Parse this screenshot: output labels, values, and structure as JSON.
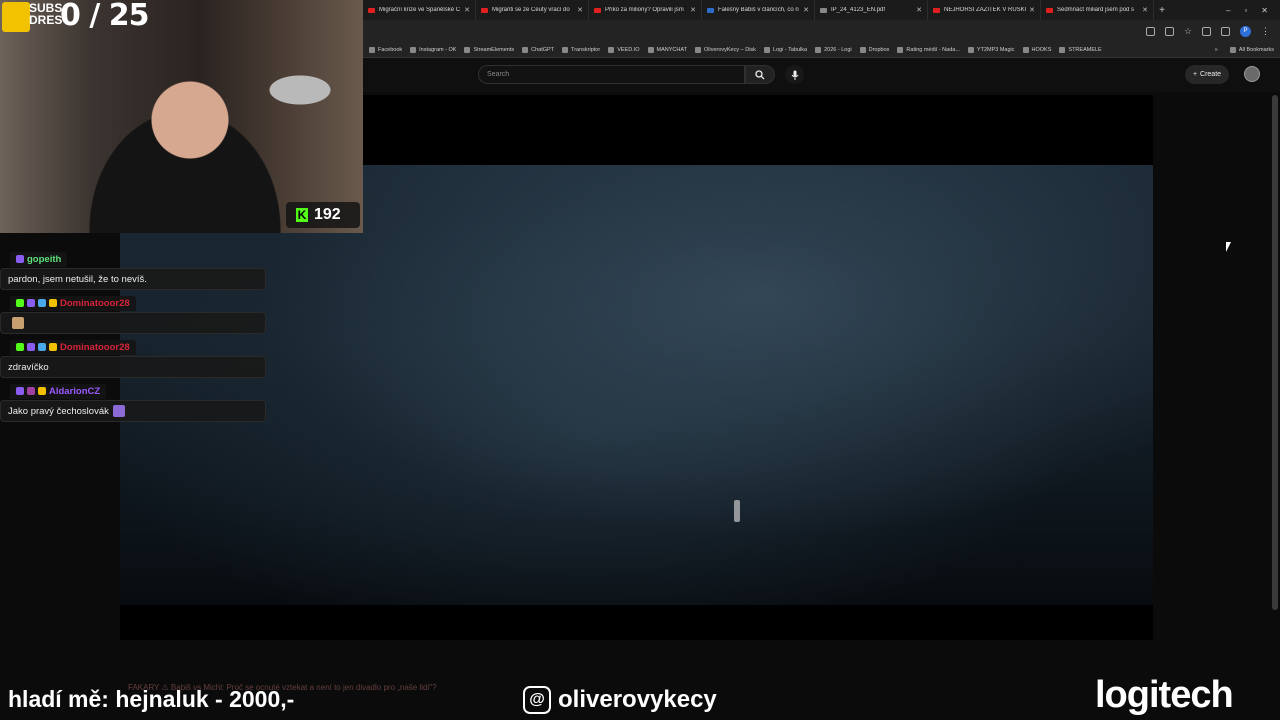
{
  "browser": {
    "tabs": [
      {
        "title": "Migrační krize ve Španělské C",
        "icon": "youtube-icon"
      },
      {
        "title": "Migranti se ze Ceuty vrací do",
        "icon": "youtube-icon"
      },
      {
        "title": "Příko za miliony? Opravili jsm",
        "icon": "youtube-icon"
      },
      {
        "title": "Falešný Babiš v článcích, co n",
        "icon": "szz-icon"
      },
      {
        "title": "IP_24_4123_EN.pdf",
        "icon": "pdf-icon"
      },
      {
        "title": "NEJHORŠÍ ZÁŽITEK V RUSKU!",
        "icon": "youtube-icon"
      },
      {
        "title": "Sedmnáct miliard jsem pod s",
        "icon": "youtube-icon"
      }
    ],
    "new_tab": "+",
    "window_controls": [
      "–",
      "▫",
      "✕"
    ],
    "profile_initial": "P",
    "bookmarks": [
      "Facebook",
      "Instagram - OK",
      "StreamElements",
      "ChatGPT",
      "Transkriptor",
      "VEED.IO",
      "MANYCHAT",
      "OliverovyKecy – Disk",
      "Logi - Tabulka",
      "2026 - Logi",
      "Dropbox",
      "Rating médií - Nada...",
      "YT2MP3 Magic",
      "HOOKS",
      "STREAMELE"
    ],
    "bookmarks_more": "»",
    "all_bookmarks": "All Bookmarks"
  },
  "youtube": {
    "search_placeholder": "Search",
    "create_label": "Create"
  },
  "overlay": {
    "subs_logo": "SUBS DRES",
    "subs_count": "0 / 25",
    "kick_count": "192",
    "ticker": "FAKARY ⚠ Babiš vs Michl: Proč se ocnuté vztekat a není to jen divadlo pro „naše lidi\"?",
    "bottom_left": "hladí mě: hejnaluk - 2000,-",
    "threads_handle": "oliverovykecy",
    "sponsor": "logitech"
  },
  "chat": [
    {
      "user": "gopeith",
      "color": "#5ee07a",
      "badges": [
        "#8a5cf0"
      ],
      "text": "pardon, jsem netušil, že to nevíš.",
      "emote": false
    },
    {
      "user": "Dominatooor28",
      "color": "#d6243a",
      "badges": [
        "#53fc18",
        "#8a5cf0",
        "#4aa8e8",
        "#f2c200"
      ],
      "text": "",
      "emote": true
    },
    {
      "user": "Dominatooor28",
      "color": "#d6243a",
      "badges": [
        "#53fc18",
        "#8a5cf0",
        "#4aa8e8",
        "#f2c200"
      ],
      "text": "zdravíčko",
      "emote": false
    },
    {
      "user": "AldarionCZ",
      "color": "#9b59ff",
      "badges": [
        "#8a5cf0",
        "#a040a0",
        "#f2c200"
      ],
      "text": "Jako pravý čechoslovák",
      "emote": true
    }
  ]
}
